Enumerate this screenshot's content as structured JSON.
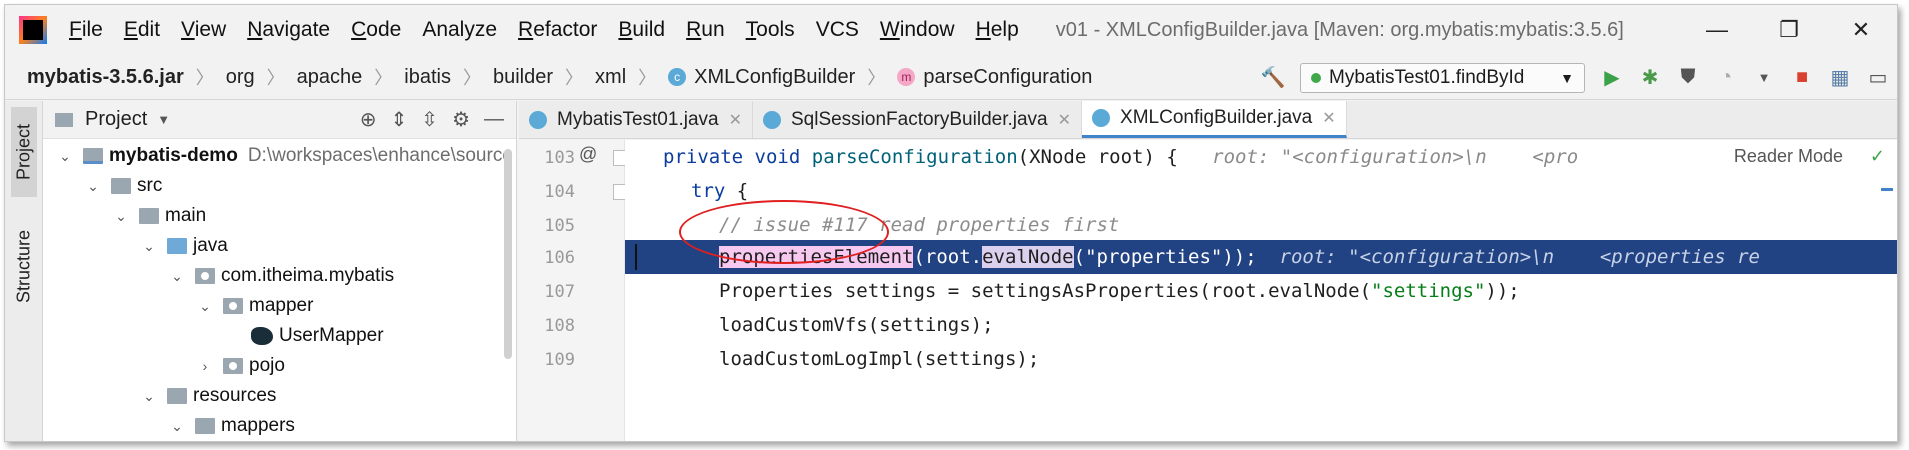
{
  "menubar": {
    "items": [
      {
        "label": "File",
        "u": "F",
        "rest": "ile"
      },
      {
        "label": "Edit",
        "u": "E",
        "rest": "dit"
      },
      {
        "label": "View",
        "u": "V",
        "rest": "iew"
      },
      {
        "label": "Navigate",
        "u": "N",
        "rest": "avigate"
      },
      {
        "label": "Code",
        "u": "C",
        "rest": "ode"
      },
      {
        "label": "Analyze",
        "u": "",
        "rest": "Analyze"
      },
      {
        "label": "Refactor",
        "u": "R",
        "rest": "efactor"
      },
      {
        "label": "Build",
        "u": "B",
        "rest": "uild"
      },
      {
        "label": "Run",
        "u": "R",
        "rest": "un"
      },
      {
        "label": "Tools",
        "u": "T",
        "rest": "ools"
      },
      {
        "label": "VCS",
        "u": "",
        "rest": "VCS"
      },
      {
        "label": "Window",
        "u": "W",
        "rest": "indow"
      },
      {
        "label": "Help",
        "u": "H",
        "rest": "elp"
      }
    ],
    "title": "v01 - XMLConfigBuilder.java [Maven: org.mybatis:mybatis:3.5.6]"
  },
  "window_controls": {
    "minimize": "—",
    "maximize": "❐",
    "close": "✕"
  },
  "breadcrumb": {
    "items": [
      "mybatis-3.5.6.jar",
      "org",
      "apache",
      "ibatis",
      "builder",
      "xml",
      "XMLConfigBuilder",
      "parseConfiguration"
    ],
    "class_icon_letter": "c",
    "method_icon_letter": "m"
  },
  "toolbar": {
    "run_config": "MybatisTest01.findById"
  },
  "side_tabs": {
    "project": "Project",
    "structure": "Structure"
  },
  "project_panel": {
    "title": "Project",
    "tree": [
      {
        "label": "mybatis-demo",
        "path": "D:\\workspaces\\enhance\\source"
      },
      {
        "label": "src"
      },
      {
        "label": "main"
      },
      {
        "label": "java"
      },
      {
        "label": "com.itheima.mybatis"
      },
      {
        "label": "mapper"
      },
      {
        "label": "UserMapper"
      },
      {
        "label": "pojo"
      },
      {
        "label": "resources"
      },
      {
        "label": "mappers"
      }
    ]
  },
  "editor_tabs": [
    {
      "label": "MybatisTest01.java"
    },
    {
      "label": "SqlSessionFactoryBuilder.java"
    },
    {
      "label": "XMLConfigBuilder.java"
    }
  ],
  "editor": {
    "reader_mode": "Reader Mode",
    "gutter_annotation": "@",
    "line_numbers": [
      "103",
      "104",
      "105",
      "106",
      "107",
      "108",
      "109"
    ],
    "l103": {
      "kw1": "private",
      "kw2": "void",
      "fn": "parseConfiguration",
      "rest": "(XNode root) {",
      "hint": "root: \"<configuration>\\n    <pro"
    },
    "l104": {
      "kw": "try",
      "rest": " {"
    },
    "l105": {
      "comment": "// issue #117 read properties first"
    },
    "l106": {
      "call": "propertiesElement",
      "mid": "(root.",
      "call2": "evalNode",
      "str": "(\"properties\"));",
      "hint": "root: \"<configuration>\\n    <properties re"
    },
    "l107": {
      "pre": "Properties settings = settingsAsProperties(root.evalNode(",
      "str": "\"settings\"",
      "post": "));"
    },
    "l108": {
      "text": "loadCustomVfs(settings);"
    },
    "l109": {
      "text": "loadCustomLogImpl(settings);"
    }
  }
}
